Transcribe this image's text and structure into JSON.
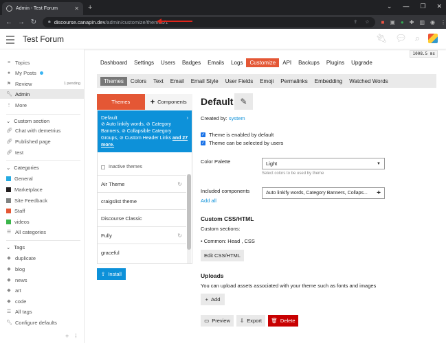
{
  "browser": {
    "tab_title": "Admin - Test Forum",
    "url_host": "discourse.canapin.dev",
    "url_path": "/admin/customize/themes/1"
  },
  "header": {
    "site_title": "Test Forum",
    "timing": "1008.5 ms"
  },
  "sidebar": {
    "items": [
      {
        "label": "Topics",
        "icon": "layers-icon"
      },
      {
        "label": "My Posts",
        "icon": "user-icon"
      },
      {
        "label": "Review",
        "icon": "flag-icon",
        "badge": "1 pending"
      },
      {
        "label": "Admin",
        "icon": "wrench-icon"
      },
      {
        "label": "More",
        "icon": "ellipsis-icon"
      }
    ],
    "custom_section": {
      "title": "Custom section",
      "items": [
        "Chat with demetrius",
        "Published page",
        "test"
      ]
    },
    "categories": {
      "title": "Categories",
      "items": [
        {
          "label": "General",
          "color": "#25aae1"
        },
        {
          "label": "Marketplace",
          "color": "#231f20"
        },
        {
          "label": "Site Feedback",
          "color": "#808281"
        },
        {
          "label": "Staff",
          "color": "#e45735"
        },
        {
          "label": "videos",
          "color": "#3ab54a"
        },
        {
          "label": "All categories",
          "color": ""
        }
      ]
    },
    "tags": {
      "title": "Tags",
      "items": [
        "duplicate",
        "blog",
        "news",
        "art",
        "code",
        "All tags",
        "Configure defaults"
      ]
    }
  },
  "admin_nav": [
    "Dashboard",
    "Settings",
    "Users",
    "Badges",
    "Emails",
    "Logs",
    "Customize",
    "API",
    "Backups",
    "Plugins",
    "Upgrade"
  ],
  "admin_nav_active": "Customize",
  "sub_nav": [
    "Themes",
    "Colors",
    "Text",
    "Email",
    "Email Style",
    "User Fields",
    "Emoji",
    "Permalinks",
    "Embedding",
    "Watched Words"
  ],
  "sub_nav_active": "Themes",
  "theme_list": {
    "tab_themes": "Themes",
    "tab_components": "Components",
    "default_theme": {
      "name": "Default",
      "components": "⊘ Auto linkify words, ⊘ Category Banners, ⊘ Collapsible Category Groups, ⊘ Custom Header Links",
      "more": "and 27 more."
    },
    "inactive_label": "Inactive themes",
    "inactive": [
      {
        "name": "Air Theme",
        "sync": true
      },
      {
        "name": "craigslist theme",
        "sync": false
      },
      {
        "name": "Discourse Classic",
        "sync": false
      },
      {
        "name": "Fully",
        "sync": true
      },
      {
        "name": "graceful",
        "sync": false
      }
    ],
    "install_label": "Install"
  },
  "detail": {
    "title": "Default",
    "created_by_label": "Created by:",
    "created_by_user": "system",
    "checkbox_default": "Theme is enabled by default",
    "checkbox_selectable": "Theme can be selected by users",
    "palette_label": "Color Palette",
    "palette_value": "Light",
    "palette_hint": "Select colors to be used by theme",
    "components_label": "Included components",
    "components_value": "Auto linkify words, Category Banners, Collaps...",
    "add_all": "Add all",
    "css_title": "Custom CSS/HTML",
    "custom_sections_label": "Custom sections:",
    "custom_sections_item": "Common: Head , CSS",
    "edit_css_button": "Edit CSS/HTML",
    "uploads_title": "Uploads",
    "uploads_text": "You can upload assets associated with your theme such as fonts and images",
    "add_button": "Add",
    "preview_button": "Preview",
    "export_button": "Export",
    "delete_button": "Delete"
  },
  "colors": {
    "accent": "#e45735",
    "primary_blue": "#0d91d9",
    "danger": "#c80001"
  }
}
